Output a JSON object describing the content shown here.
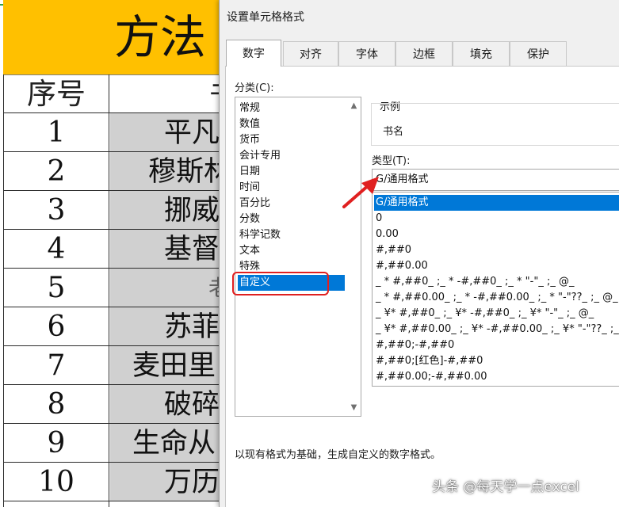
{
  "sheet": {
    "title": "方法",
    "headers": [
      "序号",
      "书"
    ],
    "rows": [
      {
        "num": "1",
        "name": "平凡"
      },
      {
        "num": "2",
        "name": "穆斯林"
      },
      {
        "num": "3",
        "name": "挪威"
      },
      {
        "num": "4",
        "name": "基督"
      },
      {
        "num": "5",
        "name": "老"
      },
      {
        "num": "6",
        "name": "苏菲"
      },
      {
        "num": "7",
        "name": "麦田里"
      },
      {
        "num": "8",
        "name": "破碎"
      },
      {
        "num": "9",
        "name": "生命从"
      },
      {
        "num": "10",
        "name": "万历"
      }
    ],
    "colors": {
      "title_band": "#ffc000",
      "name_fill": "#d0d0d0"
    }
  },
  "dialog": {
    "title": "设置单元格格式",
    "tabs": [
      "数字",
      "对齐",
      "字体",
      "边框",
      "填充",
      "保护"
    ],
    "active_tab": "数字",
    "category_label": "分类(C):",
    "categories": [
      "常规",
      "数值",
      "货币",
      "会计专用",
      "日期",
      "时间",
      "百分比",
      "分数",
      "科学记数",
      "文本",
      "特殊",
      "自定义"
    ],
    "selected_category": "自定义",
    "sample_label": "示例",
    "sample_value": "书名",
    "type_label": "类型(T):",
    "type_value": "G/通用格式",
    "formats": [
      "G/通用格式",
      "0",
      "0.00",
      "#,##0",
      "#,##0.00",
      "_ * #,##0_ ;_ * -#,##0_ ;_ * \"-\"_ ;_ @_",
      "_ * #,##0.00_ ;_ * -#,##0.00_ ;_ * \"-\"??_ ;_ @_",
      "_ ¥* #,##0_ ;_ ¥* -#,##0_ ;_ ¥* \"-\"_ ;_ @_",
      "_ ¥* #,##0.00_ ;_ ¥* -#,##0.00_ ;_ ¥* \"-\"??_ ;_ @_",
      "#,##0;-#,##0",
      "#,##0;[红色]-#,##0",
      "#,##0.00;-#,##0.00"
    ],
    "selected_format": "G/通用格式",
    "description": "以现有格式为基础，生成自定义的数字格式。",
    "selection_color": "#0078d7",
    "annotation_color": "#e02020"
  },
  "watermark": "头条 @每天学一点excel",
  "icons": {
    "scroll_up": "chevron-up-icon",
    "scroll_down": "chevron-down-icon"
  }
}
